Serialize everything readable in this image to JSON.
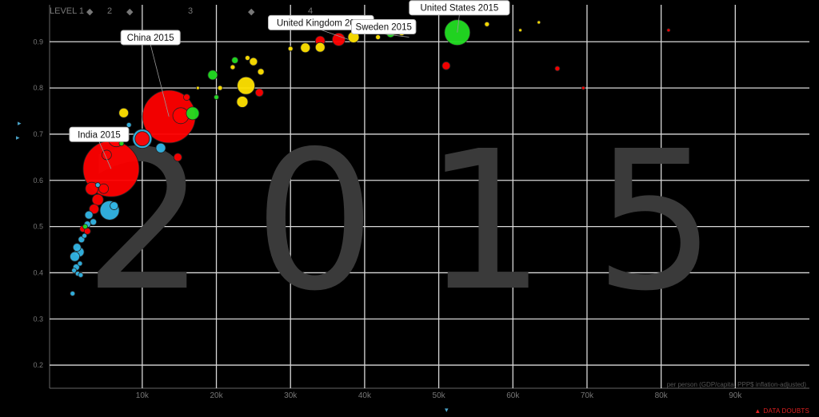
{
  "levels": {
    "label": "LEVEL 1",
    "items": [
      "2",
      "3",
      "4"
    ]
  },
  "chart_data": {
    "type": "scatter",
    "title": "",
    "year_watermark": "2015",
    "xlabel": "per person (GDP/capita, PPP$ inflation-adjusted)",
    "ylabel": "",
    "xlim": [
      -2500,
      100000
    ],
    "ylim": [
      0.15,
      0.98
    ],
    "x_ticks": [
      10000,
      20000,
      30000,
      40000,
      50000,
      60000,
      70000,
      80000,
      90000
    ],
    "x_tick_labels": [
      "10k",
      "20k",
      "30k",
      "40k",
      "50k",
      "60k",
      "70k",
      "80k",
      "90k"
    ],
    "y_ticks": [
      0.2,
      0.3,
      0.4,
      0.5,
      0.6,
      0.7,
      0.8,
      0.9
    ],
    "y_tick_labels": [
      "0.2",
      "0.3",
      "0.4",
      "0.5",
      "0.6",
      "0.7",
      "0.8",
      "0.9"
    ],
    "grid": true,
    "annotations": [
      {
        "text": "India 2015",
        "x": 5800,
        "y": 0.625
      },
      {
        "text": "China 2015",
        "x": 13600,
        "y": 0.738
      },
      {
        "text": "United Kingdom 2015",
        "x": 37800,
        "y": 0.905
      },
      {
        "text": "Sweden 2015",
        "x": 46000,
        "y": 0.91
      },
      {
        "text": "United States 2015",
        "x": 52500,
        "y": 0.92
      }
    ],
    "colors": {
      "blue": "#33b5e5",
      "red": "#ff0000",
      "yellow": "#ffe200",
      "green": "#22dd22",
      "orange": "#ff7a00"
    },
    "points": [
      {
        "x": 5800,
        "y": 0.625,
        "r": 35,
        "c": "red"
      },
      {
        "x": 13600,
        "y": 0.738,
        "r": 33,
        "c": "red"
      },
      {
        "x": 52500,
        "y": 0.92,
        "r": 16,
        "c": "green"
      },
      {
        "x": 36500,
        "y": 0.905,
        "r": 8,
        "c": "red"
      },
      {
        "x": 34000,
        "y": 0.902,
        "r": 6,
        "c": "red"
      },
      {
        "x": 38500,
        "y": 0.91,
        "r": 7,
        "c": "yellow"
      },
      {
        "x": 44000,
        "y": 0.925,
        "r": 6,
        "c": "red"
      },
      {
        "x": 43500,
        "y": 0.918,
        "r": 5,
        "c": "green"
      },
      {
        "x": 45000,
        "y": 0.92,
        "r": 4,
        "c": "yellow"
      },
      {
        "x": 46200,
        "y": 0.924,
        "r": 4,
        "c": "yellow"
      },
      {
        "x": 41800,
        "y": 0.91,
        "r": 3,
        "c": "yellow"
      },
      {
        "x": 34000,
        "y": 0.888,
        "r": 6,
        "c": "yellow"
      },
      {
        "x": 32000,
        "y": 0.887,
        "r": 6,
        "c": "yellow"
      },
      {
        "x": 30000,
        "y": 0.885,
        "r": 3,
        "c": "yellow"
      },
      {
        "x": 56500,
        "y": 0.938,
        "r": 3,
        "c": "yellow"
      },
      {
        "x": 63500,
        "y": 0.942,
        "r": 2,
        "c": "yellow"
      },
      {
        "x": 61000,
        "y": 0.925,
        "r": 2,
        "c": "yellow"
      },
      {
        "x": 51000,
        "y": 0.848,
        "r": 5,
        "c": "red"
      },
      {
        "x": 66000,
        "y": 0.842,
        "r": 3,
        "c": "red"
      },
      {
        "x": 69500,
        "y": 0.8,
        "r": 2,
        "c": "red"
      },
      {
        "x": 81000,
        "y": 0.925,
        "r": 2,
        "c": "red"
      },
      {
        "x": 24000,
        "y": 0.805,
        "r": 11,
        "c": "yellow"
      },
      {
        "x": 25000,
        "y": 0.857,
        "r": 5,
        "c": "yellow"
      },
      {
        "x": 26000,
        "y": 0.835,
        "r": 4,
        "c": "yellow"
      },
      {
        "x": 23500,
        "y": 0.77,
        "r": 7,
        "c": "yellow"
      },
      {
        "x": 24200,
        "y": 0.865,
        "r": 3,
        "c": "yellow"
      },
      {
        "x": 22200,
        "y": 0.845,
        "r": 3,
        "c": "yellow"
      },
      {
        "x": 20500,
        "y": 0.8,
        "r": 3,
        "c": "yellow"
      },
      {
        "x": 25800,
        "y": 0.79,
        "r": 5,
        "c": "red"
      },
      {
        "x": 19500,
        "y": 0.828,
        "r": 6,
        "c": "green"
      },
      {
        "x": 22500,
        "y": 0.86,
        "r": 4,
        "c": "green"
      },
      {
        "x": 16800,
        "y": 0.745,
        "r": 8,
        "c": "green"
      },
      {
        "x": 16000,
        "y": 0.78,
        "r": 4,
        "c": "red"
      },
      {
        "x": 15200,
        "y": 0.74,
        "r": 10,
        "c": "red"
      },
      {
        "x": 14800,
        "y": 0.65,
        "r": 5,
        "c": "red"
      },
      {
        "x": 17500,
        "y": 0.8,
        "r": 2,
        "c": "yellow"
      },
      {
        "x": 20000,
        "y": 0.78,
        "r": 3,
        "c": "green"
      },
      {
        "x": 7500,
        "y": 0.746,
        "r": 6,
        "c": "yellow"
      },
      {
        "x": 10000,
        "y": 0.69,
        "r": 12,
        "c": "blue"
      },
      {
        "x": 10000,
        "y": 0.69,
        "r": 9,
        "c": "red"
      },
      {
        "x": 12500,
        "y": 0.67,
        "r": 6,
        "c": "blue"
      },
      {
        "x": 6500,
        "y": 0.69,
        "r": 10,
        "c": "red"
      },
      {
        "x": 4500,
        "y": 0.7,
        "r": 7,
        "c": "red"
      },
      {
        "x": 5200,
        "y": 0.655,
        "r": 6,
        "c": "red"
      },
      {
        "x": 3200,
        "y": 0.582,
        "r": 8,
        "c": "red"
      },
      {
        "x": 4800,
        "y": 0.582,
        "r": 6,
        "c": "red"
      },
      {
        "x": 4000,
        "y": 0.558,
        "r": 7,
        "c": "red"
      },
      {
        "x": 5600,
        "y": 0.535,
        "r": 12,
        "c": "blue"
      },
      {
        "x": 6200,
        "y": 0.545,
        "r": 5,
        "c": "blue"
      },
      {
        "x": 3500,
        "y": 0.538,
        "r": 6,
        "c": "red"
      },
      {
        "x": 2800,
        "y": 0.525,
        "r": 5,
        "c": "blue"
      },
      {
        "x": 2600,
        "y": 0.505,
        "r": 4,
        "c": "blue"
      },
      {
        "x": 3400,
        "y": 0.51,
        "r": 4,
        "c": "blue"
      },
      {
        "x": 2000,
        "y": 0.495,
        "r": 4,
        "c": "red"
      },
      {
        "x": 2600,
        "y": 0.49,
        "r": 4,
        "c": "red"
      },
      {
        "x": 2200,
        "y": 0.48,
        "r": 3,
        "c": "blue"
      },
      {
        "x": 1800,
        "y": 0.472,
        "r": 4,
        "c": "blue"
      },
      {
        "x": 1200,
        "y": 0.455,
        "r": 5,
        "c": "blue"
      },
      {
        "x": 1500,
        "y": 0.445,
        "r": 6,
        "c": "blue"
      },
      {
        "x": 900,
        "y": 0.435,
        "r": 6,
        "c": "blue"
      },
      {
        "x": 1600,
        "y": 0.42,
        "r": 3,
        "c": "blue"
      },
      {
        "x": 1100,
        "y": 0.412,
        "r": 4,
        "c": "blue"
      },
      {
        "x": 800,
        "y": 0.405,
        "r": 3,
        "c": "blue"
      },
      {
        "x": 1300,
        "y": 0.398,
        "r": 3,
        "c": "blue"
      },
      {
        "x": 1700,
        "y": 0.395,
        "r": 3,
        "c": "blue"
      },
      {
        "x": 600,
        "y": 0.355,
        "r": 3,
        "c": "blue"
      },
      {
        "x": 2300,
        "y": 0.5,
        "r": 3,
        "c": "green"
      },
      {
        "x": 4000,
        "y": 0.59,
        "r": 3,
        "c": "blue"
      },
      {
        "x": 7200,
        "y": 0.68,
        "r": 3,
        "c": "green"
      },
      {
        "x": 8200,
        "y": 0.72,
        "r": 3,
        "c": "blue"
      }
    ]
  },
  "data_doubts": {
    "label": "DATA DOUBTS",
    "icon": "warning-triangle-icon"
  }
}
